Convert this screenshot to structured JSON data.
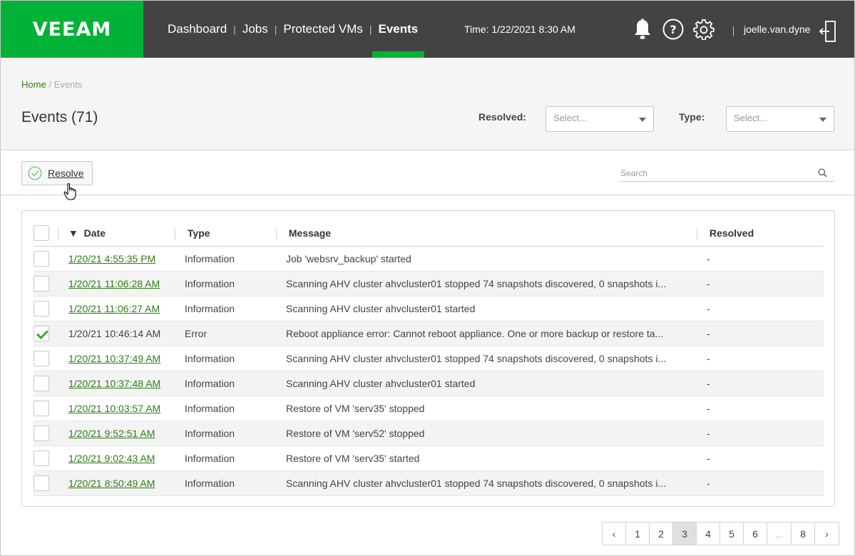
{
  "app": {
    "brand": "VEEAM"
  },
  "nav": [
    {
      "label": "Dashboard"
    },
    {
      "label": "Jobs"
    },
    {
      "label": "Protected VMs"
    },
    {
      "label": "Events"
    }
  ],
  "header": {
    "time": "Time: 1/22/2021 8:30 AM",
    "user": "joelle.van.dyne"
  },
  "breadcrumb": {
    "home": "Home",
    "sep": "/",
    "current": "Events"
  },
  "page": {
    "title": "Events (71)"
  },
  "filters": {
    "resolved_label": "Resolved:",
    "resolved_value": "Select...",
    "type_label": "Type:",
    "type_value": "Select..."
  },
  "toolbar": {
    "resolve_label": "Resolve",
    "search_placeholder": "Search"
  },
  "table": {
    "headers": {
      "sort_indicator": "▼",
      "date": "Date",
      "type": "Type",
      "message": "Message",
      "resolved": "Resolved"
    },
    "rows": [
      {
        "date": "1/20/21 4:55:35 PM",
        "type": "Information",
        "message": "Job 'websrv_backup' started",
        "resolved": "-"
      },
      {
        "date": "1/20/21 11:06:28 AM",
        "type": "Information",
        "message": "Scanning AHV cluster ahvcluster01 stopped 74 snapshots discovered, 0 snapshots i...",
        "resolved": "-"
      },
      {
        "date": "1/20/21 11:06:27 AM",
        "type": "Information",
        "message": "Scanning AHV cluster ahvcluster01 started",
        "resolved": "-"
      },
      {
        "date": "1/20/21 10:46:14 AM",
        "type": "Error",
        "message": "Reboot appliance error: Cannot reboot appliance. One or more backup or restore ta...",
        "resolved": "-"
      },
      {
        "date": "1/20/21 10:37:49 AM",
        "type": "Information",
        "message": "Scanning AHV cluster ahvcluster01 stopped 74 snapshots discovered, 0 snapshots i...",
        "resolved": "-"
      },
      {
        "date": "1/20/21 10:37:48 AM",
        "type": "Information",
        "message": "Scanning AHV cluster ahvcluster01 started",
        "resolved": "-"
      },
      {
        "date": "1/20/21 10:03:57 AM",
        "type": "Information",
        "message": "Restore of VM 'serv35' stopped",
        "resolved": "-"
      },
      {
        "date": "1/20/21 9:52:51 AM",
        "type": "Information",
        "message": "Restore of VM 'serv52' stopped",
        "resolved": "-"
      },
      {
        "date": "1/20/21 9:02:43 AM",
        "type": "Information",
        "message": "Restore of VM 'serv35' started",
        "resolved": "-"
      },
      {
        "date": "1/20/21 8:50:49 AM",
        "type": "Information",
        "message": "Scanning AHV cluster ahvcluster01 stopped 74 snapshots discovered, 0 snapshots i...",
        "resolved": "-"
      }
    ]
  },
  "pagination": [
    "‹",
    "1",
    "2",
    "3",
    "4",
    "5",
    "6",
    "...",
    "8",
    "›"
  ],
  "colors": {
    "brand_green": "#00b336",
    "header_bg": "#434343",
    "link_green": "#2e7d15"
  },
  "icons": [
    "bell-icon",
    "help-icon",
    "gear-icon",
    "logout-icon",
    "resolve-check-icon",
    "search-icon",
    "hand-cursor-icon"
  ]
}
